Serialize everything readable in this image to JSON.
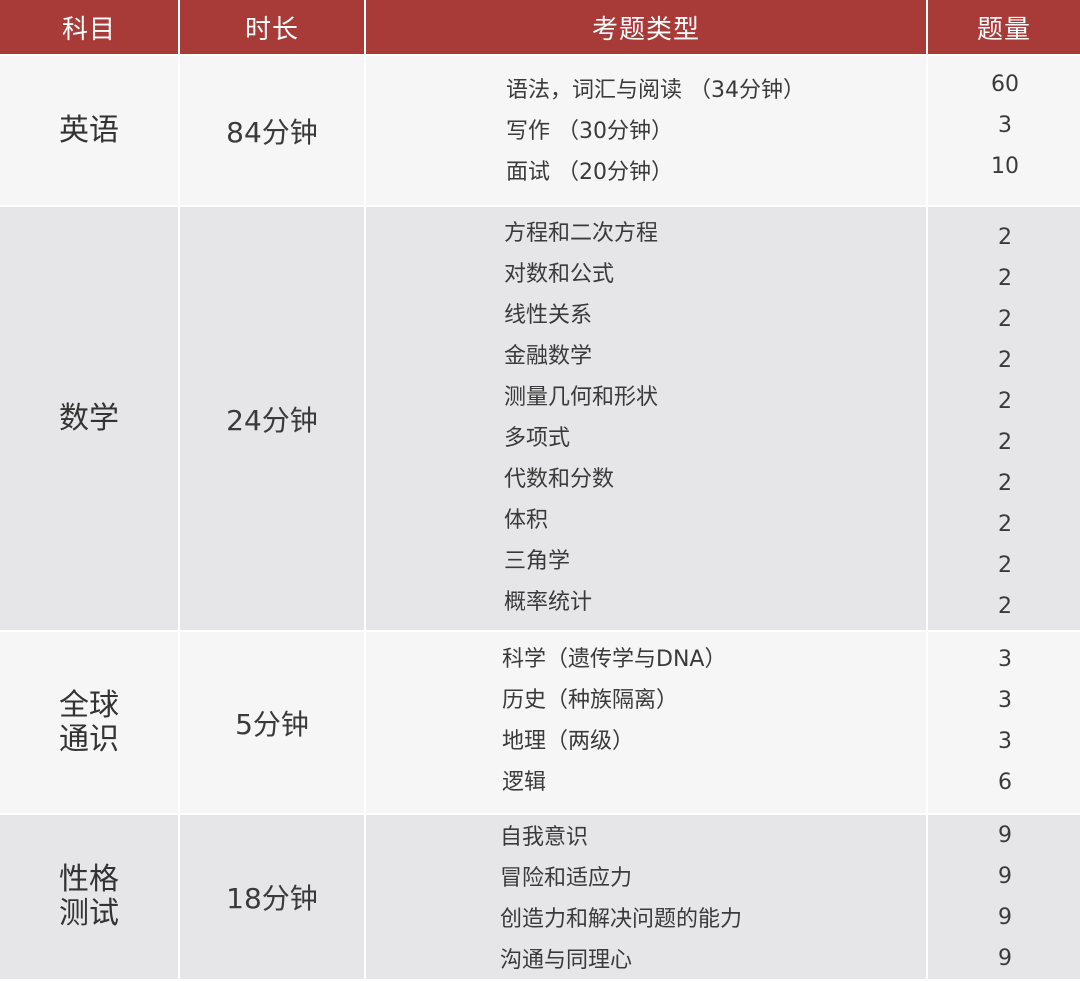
{
  "header": {
    "subject": "科目",
    "duration": "时长",
    "question_types": "考题类型",
    "count": "题量"
  },
  "rows": [
    {
      "subject": "英语",
      "duration": "84分钟",
      "items": [
        {
          "type": "语法，词汇与阅读 （34分钟）",
          "count": "60"
        },
        {
          "type": "写作 （30分钟）",
          "count": "3"
        },
        {
          "type": "面试 （20分钟）",
          "count": "10"
        }
      ]
    },
    {
      "subject": "数学",
      "duration": "24分钟",
      "items": [
        {
          "type": "方程和二次方程",
          "count": "2"
        },
        {
          "type": "对数和公式",
          "count": "2"
        },
        {
          "type": "线性关系",
          "count": "2"
        },
        {
          "type": "金融数学",
          "count": "2"
        },
        {
          "type": "测量几何和形状",
          "count": "2"
        },
        {
          "type": "多项式",
          "count": "2"
        },
        {
          "type": "代数和分数",
          "count": "2"
        },
        {
          "type": "体积",
          "count": "2"
        },
        {
          "type": "三角学",
          "count": "2"
        },
        {
          "type": "概率统计",
          "count": "2"
        }
      ]
    },
    {
      "subject": "全球通识",
      "duration": "5分钟",
      "items": [
        {
          "type": "科学（遗传学与DNA）",
          "count": "3"
        },
        {
          "type": "历史（种族隔离）",
          "count": "3"
        },
        {
          "type": "地理（两级）",
          "count": "3"
        },
        {
          "type": "逻辑",
          "count": "6"
        }
      ]
    },
    {
      "subject": "性格测试",
      "duration": "18分钟",
      "items": [
        {
          "type": "自我意识",
          "count": "9"
        },
        {
          "type": "冒险和适应力",
          "count": "9"
        },
        {
          "type": "创造力和解决问题的能力",
          "count": "9"
        },
        {
          "type": "沟通与同理心",
          "count": "9"
        }
      ]
    }
  ],
  "colors": {
    "header_bg": "#a83a37",
    "row_light": "#f6f6f6",
    "row_dark": "#e6e6e8"
  }
}
